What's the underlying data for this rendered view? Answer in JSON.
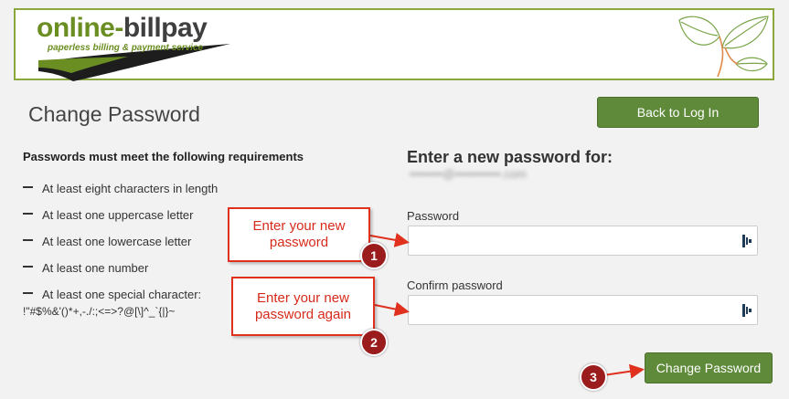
{
  "header": {
    "logo_part1": "online-",
    "logo_part2": "billpay",
    "tagline": "paperless billing & payment service"
  },
  "page": {
    "title": "Change Password"
  },
  "buttons": {
    "back": "Back to Log In",
    "change": "Change Password"
  },
  "requirements": {
    "title": "Passwords must meet the following requirements",
    "items": [
      "At least eight characters in length",
      "At least one uppercase letter",
      "At least one lowercase letter",
      "At least one number",
      "At least one special character:"
    ],
    "special_chars": "!\"#$%&'()*+,-./:;<=>?@[\\]^_`{|}~"
  },
  "form": {
    "heading": "Enter a new password for:",
    "email": "••••••••@•••••••••••.com",
    "password_label": "Password",
    "confirm_label": "Confirm password"
  },
  "annotations": [
    {
      "text": "Enter your new password",
      "number": "1"
    },
    {
      "text": "Enter your new password again",
      "number": "2"
    },
    {
      "number": "3"
    }
  ],
  "colors": {
    "accent_green": "#5e8a3a",
    "callout_red": "#e0301e",
    "badge_red": "#9b1c1c"
  }
}
